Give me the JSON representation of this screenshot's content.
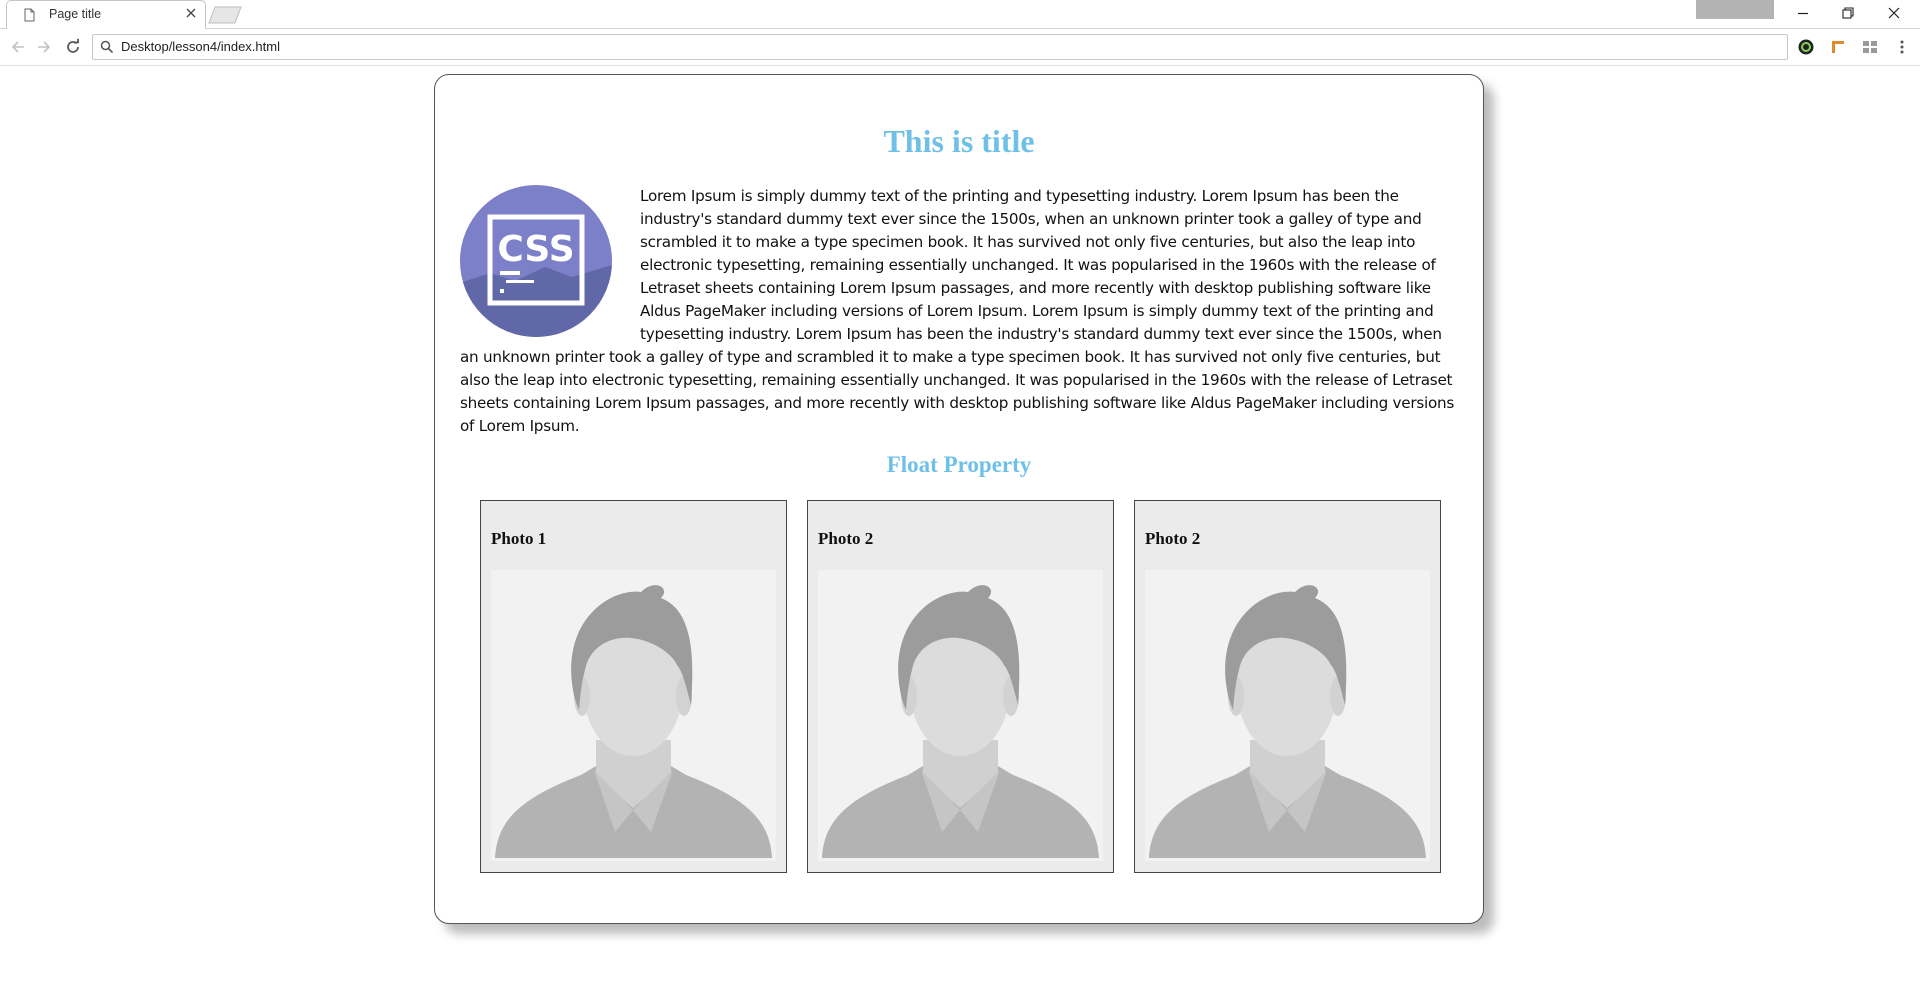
{
  "browser": {
    "tab_title": "Page title",
    "url": "Desktop/lesson4/index.html"
  },
  "page": {
    "title": "This is title",
    "logo_text": "CSS",
    "paragraph": "Lorem Ipsum is simply dummy text of the printing and typesetting industry. Lorem Ipsum has been the industry's standard dummy text ever since the 1500s, when an unknown printer took a galley of type and scrambled it to make a type specimen book. It has survived not only five centuries, but also the leap into electronic typesetting, remaining essentially unchanged. It was popularised in the 1960s with the release of Letraset sheets containing Lorem Ipsum passages, and more recently with desktop publishing software like Aldus PageMaker including versions of Lorem Ipsum. Lorem Ipsum is simply dummy text of the printing and typesetting industry. Lorem Ipsum has been the industry's standard dummy text ever since the 1500s, when an unknown printer took a galley of type and scrambled it to make a type specimen book. It has survived not only five centuries, but also the leap into electronic typesetting, remaining essentially unchanged. It was popularised in the 1960s with the release of Letraset sheets containing Lorem Ipsum passages, and more recently with desktop publishing software like Aldus PageMaker including versions of Lorem Ipsum.",
    "subtitle": "Float Property",
    "photos": [
      {
        "label": "Photo 1"
      },
      {
        "label": "Photo 2"
      },
      {
        "label": "Photo 2"
      }
    ]
  },
  "icons": [
    "page-icon",
    "close-icon",
    "new-tab-icon",
    "minimize-icon",
    "restore-icon",
    "window-close-icon",
    "back-icon",
    "forward-icon",
    "reload-icon",
    "search-icon",
    "extension-icon",
    "css-logo-icon",
    "avatar-placeholder-icon"
  ],
  "colors": {
    "heading": "#6fc0e6",
    "logo_circle": "#7b80c9",
    "avatar_hair": "#9c9c9c",
    "avatar_face": "#dcdcdc",
    "avatar_body": "#b3b3b3"
  }
}
